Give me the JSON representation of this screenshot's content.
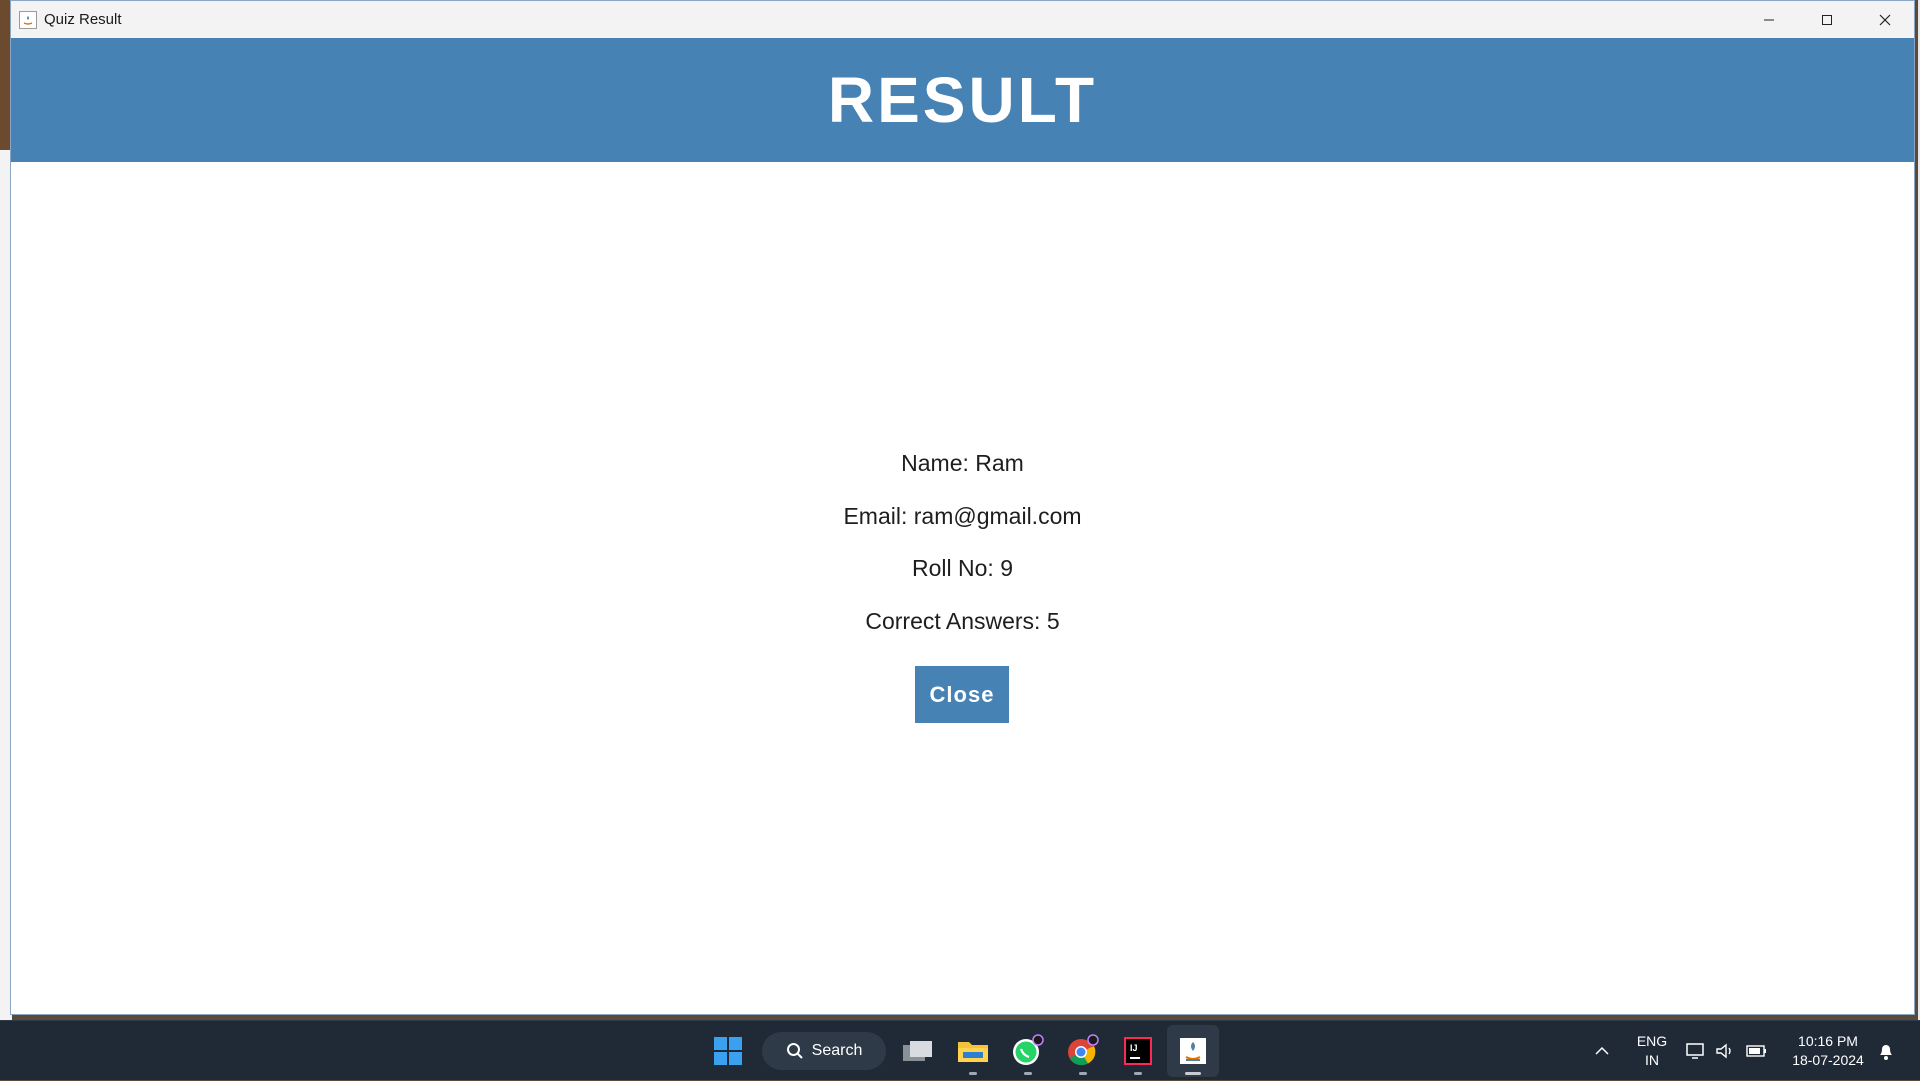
{
  "window": {
    "title": "Quiz Result"
  },
  "header": {
    "title": "RESULT",
    "background_color": "#4682b4"
  },
  "result": {
    "name_line": "Name: Ram",
    "email_line": "Email: ram@gmail.com",
    "roll_line": "Roll No: 9",
    "correct_line": "Correct Answers: 5"
  },
  "actions": {
    "close_label": "Close"
  },
  "taskbar": {
    "search_label": "Search",
    "language_top": "ENG",
    "language_bottom": "IN",
    "time": "10:16 PM",
    "date": "18-07-2024",
    "apps": [
      "windows-start",
      "task-view",
      "file-explorer",
      "whatsapp",
      "chrome",
      "intellij-idea",
      "java"
    ]
  }
}
